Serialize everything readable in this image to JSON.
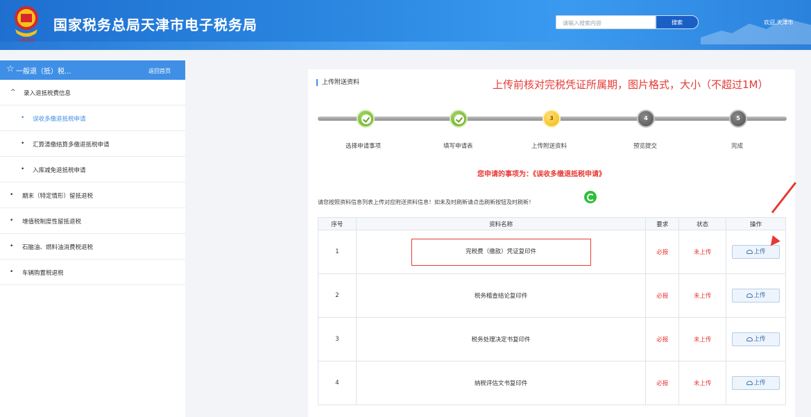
{
  "header": {
    "title": "国家税务总局天津市电子税务局",
    "emblem_caption": "中国税务",
    "search_placeholder": "请输入搜索内容",
    "search_button": "搜索",
    "welcome": "欢迎,天津市"
  },
  "sidebar": {
    "head_title": "一般退（抵）税...",
    "home_link": "返回首页",
    "items": [
      {
        "label": "录入退抵税费信息",
        "mark": "^",
        "active": false
      },
      {
        "label": "误收多缴退抵税申请",
        "mark": "•",
        "active": true
      },
      {
        "label": "汇算清缴结算多缴退抵税申请",
        "mark": "•",
        "active": false
      },
      {
        "label": "入库减免退抵税申请",
        "mark": "•",
        "active": false
      },
      {
        "label": "期末（特定情形）留抵退税",
        "mark": "•",
        "active": false
      },
      {
        "label": "增值税制度性留抵退税",
        "mark": "•",
        "active": false
      },
      {
        "label": "石脑油、燃料油消费税退税",
        "mark": "•",
        "active": false
      },
      {
        "label": "车辆购置税退税",
        "mark": "•",
        "active": false
      }
    ]
  },
  "main": {
    "section_title": "上传附送资料",
    "hint": "上传前核对完税凭证所属期，图片格式，大小（不超过1M）",
    "steps": [
      {
        "label": "选择申请事项",
        "state": "done"
      },
      {
        "label": "填写申请表",
        "state": "done"
      },
      {
        "label": "上传附送资料",
        "state": "current",
        "num": "3"
      },
      {
        "label": "预览提交",
        "state": "todo",
        "num": "4"
      },
      {
        "label": "完成",
        "state": "todo",
        "num": "5"
      }
    ],
    "apply_line": "您申请的事项为：《误收多缴退抵税申请》",
    "note": "请您按照资料信息列表上传对应附送资料信息！如未及时刷新请点击刷新按钮及时刷新！"
  },
  "table": {
    "headers": [
      "序号",
      "资料名称",
      "要求",
      "状态",
      "操作"
    ],
    "rows": [
      {
        "no": "1",
        "name": "完税费（缴款）凭证复印件",
        "req": "必报",
        "status": "未上传",
        "action": "上传"
      },
      {
        "no": "2",
        "name": "税务稽查结论复印件",
        "req": "必报",
        "status": "未上传",
        "action": "上传"
      },
      {
        "no": "3",
        "name": "税务处理决定书复印件",
        "req": "必报",
        "status": "未上传",
        "action": "上传"
      },
      {
        "no": "4",
        "name": "纳税评估文书复印件",
        "req": "必报",
        "status": "未上传",
        "action": "上传"
      }
    ]
  },
  "colors": {
    "header_blue": "#2a86e0",
    "accent_blue": "#3f8fe6",
    "warn_red": "#e53935",
    "step_done": "#6aa825",
    "step_current": "#f2b705",
    "step_todo": "#505050"
  }
}
